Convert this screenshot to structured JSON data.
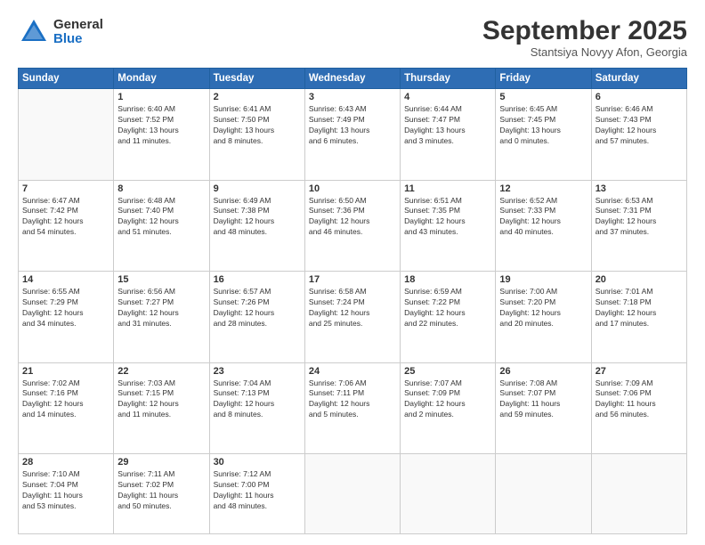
{
  "logo": {
    "general": "General",
    "blue": "Blue"
  },
  "header": {
    "month": "September 2025",
    "location": "Stantsiya Novyy Afon, Georgia"
  },
  "weekdays": [
    "Sunday",
    "Monday",
    "Tuesday",
    "Wednesday",
    "Thursday",
    "Friday",
    "Saturday"
  ],
  "weeks": [
    [
      {
        "day": "",
        "info": ""
      },
      {
        "day": "1",
        "info": "Sunrise: 6:40 AM\nSunset: 7:52 PM\nDaylight: 13 hours\nand 11 minutes."
      },
      {
        "day": "2",
        "info": "Sunrise: 6:41 AM\nSunset: 7:50 PM\nDaylight: 13 hours\nand 8 minutes."
      },
      {
        "day": "3",
        "info": "Sunrise: 6:43 AM\nSunset: 7:49 PM\nDaylight: 13 hours\nand 6 minutes."
      },
      {
        "day": "4",
        "info": "Sunrise: 6:44 AM\nSunset: 7:47 PM\nDaylight: 13 hours\nand 3 minutes."
      },
      {
        "day": "5",
        "info": "Sunrise: 6:45 AM\nSunset: 7:45 PM\nDaylight: 13 hours\nand 0 minutes."
      },
      {
        "day": "6",
        "info": "Sunrise: 6:46 AM\nSunset: 7:43 PM\nDaylight: 12 hours\nand 57 minutes."
      }
    ],
    [
      {
        "day": "7",
        "info": "Sunrise: 6:47 AM\nSunset: 7:42 PM\nDaylight: 12 hours\nand 54 minutes."
      },
      {
        "day": "8",
        "info": "Sunrise: 6:48 AM\nSunset: 7:40 PM\nDaylight: 12 hours\nand 51 minutes."
      },
      {
        "day": "9",
        "info": "Sunrise: 6:49 AM\nSunset: 7:38 PM\nDaylight: 12 hours\nand 48 minutes."
      },
      {
        "day": "10",
        "info": "Sunrise: 6:50 AM\nSunset: 7:36 PM\nDaylight: 12 hours\nand 46 minutes."
      },
      {
        "day": "11",
        "info": "Sunrise: 6:51 AM\nSunset: 7:35 PM\nDaylight: 12 hours\nand 43 minutes."
      },
      {
        "day": "12",
        "info": "Sunrise: 6:52 AM\nSunset: 7:33 PM\nDaylight: 12 hours\nand 40 minutes."
      },
      {
        "day": "13",
        "info": "Sunrise: 6:53 AM\nSunset: 7:31 PM\nDaylight: 12 hours\nand 37 minutes."
      }
    ],
    [
      {
        "day": "14",
        "info": "Sunrise: 6:55 AM\nSunset: 7:29 PM\nDaylight: 12 hours\nand 34 minutes."
      },
      {
        "day": "15",
        "info": "Sunrise: 6:56 AM\nSunset: 7:27 PM\nDaylight: 12 hours\nand 31 minutes."
      },
      {
        "day": "16",
        "info": "Sunrise: 6:57 AM\nSunset: 7:26 PM\nDaylight: 12 hours\nand 28 minutes."
      },
      {
        "day": "17",
        "info": "Sunrise: 6:58 AM\nSunset: 7:24 PM\nDaylight: 12 hours\nand 25 minutes."
      },
      {
        "day": "18",
        "info": "Sunrise: 6:59 AM\nSunset: 7:22 PM\nDaylight: 12 hours\nand 22 minutes."
      },
      {
        "day": "19",
        "info": "Sunrise: 7:00 AM\nSunset: 7:20 PM\nDaylight: 12 hours\nand 20 minutes."
      },
      {
        "day": "20",
        "info": "Sunrise: 7:01 AM\nSunset: 7:18 PM\nDaylight: 12 hours\nand 17 minutes."
      }
    ],
    [
      {
        "day": "21",
        "info": "Sunrise: 7:02 AM\nSunset: 7:16 PM\nDaylight: 12 hours\nand 14 minutes."
      },
      {
        "day": "22",
        "info": "Sunrise: 7:03 AM\nSunset: 7:15 PM\nDaylight: 12 hours\nand 11 minutes."
      },
      {
        "day": "23",
        "info": "Sunrise: 7:04 AM\nSunset: 7:13 PM\nDaylight: 12 hours\nand 8 minutes."
      },
      {
        "day": "24",
        "info": "Sunrise: 7:06 AM\nSunset: 7:11 PM\nDaylight: 12 hours\nand 5 minutes."
      },
      {
        "day": "25",
        "info": "Sunrise: 7:07 AM\nSunset: 7:09 PM\nDaylight: 12 hours\nand 2 minutes."
      },
      {
        "day": "26",
        "info": "Sunrise: 7:08 AM\nSunset: 7:07 PM\nDaylight: 11 hours\nand 59 minutes."
      },
      {
        "day": "27",
        "info": "Sunrise: 7:09 AM\nSunset: 7:06 PM\nDaylight: 11 hours\nand 56 minutes."
      }
    ],
    [
      {
        "day": "28",
        "info": "Sunrise: 7:10 AM\nSunset: 7:04 PM\nDaylight: 11 hours\nand 53 minutes."
      },
      {
        "day": "29",
        "info": "Sunrise: 7:11 AM\nSunset: 7:02 PM\nDaylight: 11 hours\nand 50 minutes."
      },
      {
        "day": "30",
        "info": "Sunrise: 7:12 AM\nSunset: 7:00 PM\nDaylight: 11 hours\nand 48 minutes."
      },
      {
        "day": "",
        "info": ""
      },
      {
        "day": "",
        "info": ""
      },
      {
        "day": "",
        "info": ""
      },
      {
        "day": "",
        "info": ""
      }
    ]
  ]
}
